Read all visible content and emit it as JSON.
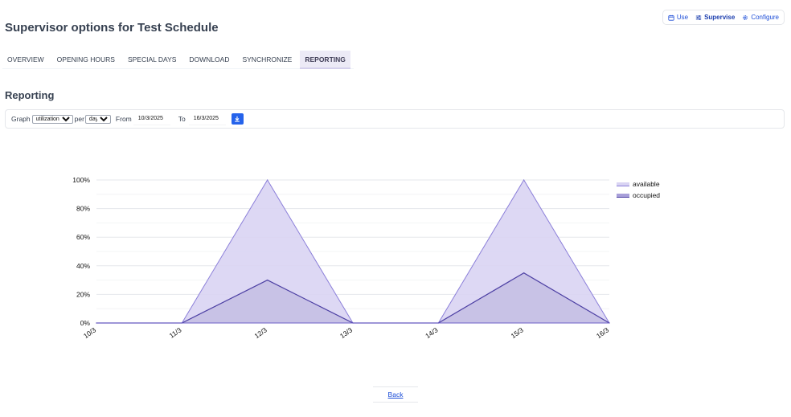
{
  "page": {
    "title": "Supervisor options for Test Schedule"
  },
  "topnav": {
    "items": [
      {
        "label": "Use",
        "icon": "calendar-icon",
        "active": false
      },
      {
        "label": "Supervise",
        "icon": "sliders-icon",
        "active": true
      },
      {
        "label": "Configure",
        "icon": "gear-icon",
        "active": false
      }
    ]
  },
  "tabs": [
    {
      "label": "OVERVIEW",
      "active": false
    },
    {
      "label": "OPENING HOURS",
      "active": false
    },
    {
      "label": "SPECIAL DAYS",
      "active": false
    },
    {
      "label": "DOWNLOAD",
      "active": false
    },
    {
      "label": "SYNCHRONIZE",
      "active": false
    },
    {
      "label": "REPORTING",
      "active": true
    }
  ],
  "section": {
    "title": "Reporting"
  },
  "controls": {
    "graph_label": "Graph",
    "graph_value": "utilization",
    "per_label": "per",
    "per_value": "day",
    "from_label": "From",
    "from_value": "10/3/2025",
    "to_label": "To",
    "to_value": "16/3/2025",
    "download_icon": "download-icon",
    "accent_color": "#2563eb"
  },
  "chart_data": {
    "type": "area",
    "x": [
      "10/3",
      "11/3",
      "12/3",
      "13/3",
      "14/3",
      "15/3",
      "16/3"
    ],
    "y_ticks": [
      "0%",
      "20%",
      "40%",
      "60%",
      "80%",
      "100%"
    ],
    "ylim": [
      0,
      100
    ],
    "grid": true,
    "legend": "top-right",
    "series": [
      {
        "name": "available",
        "values": [
          0,
          0,
          100,
          0,
          0,
          100,
          0
        ],
        "color": "#d9d4f3",
        "line": "#8b7fd9"
      },
      {
        "name": "occupied",
        "values": [
          0,
          0,
          30,
          0,
          0,
          35,
          0
        ],
        "color": "#c4bee3",
        "line": "#4c3fa3"
      }
    ]
  },
  "footer": {
    "back_label": "Back"
  }
}
